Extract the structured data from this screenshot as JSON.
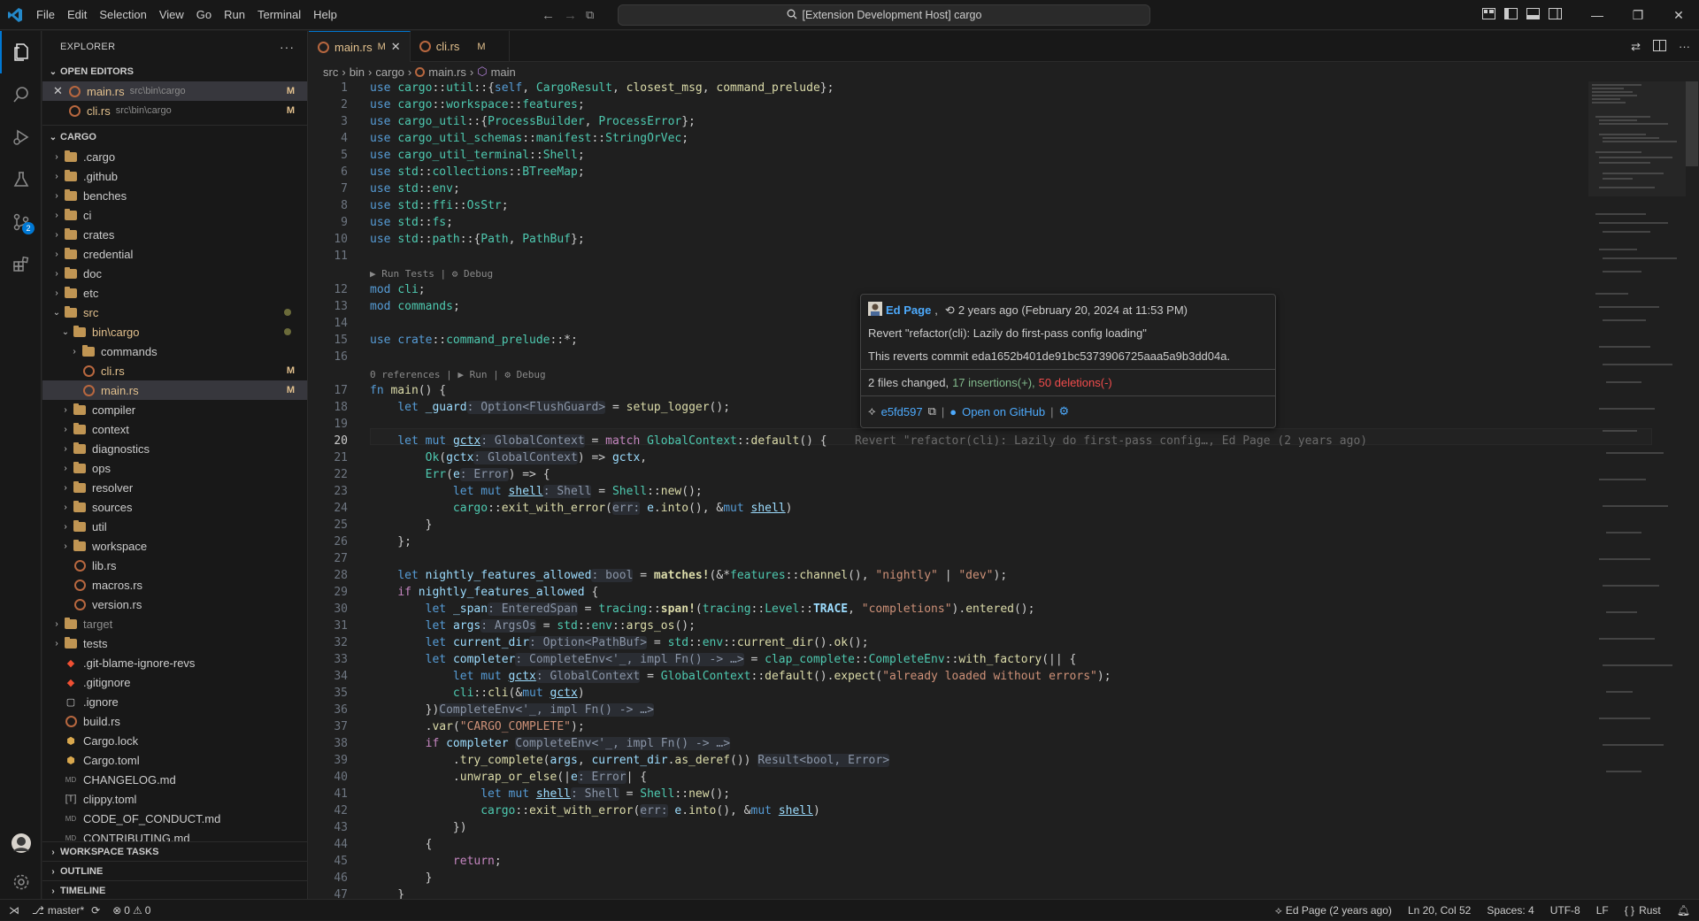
{
  "menu": [
    "File",
    "Edit",
    "Selection",
    "View",
    "Go",
    "Run",
    "Terminal",
    "Help"
  ],
  "command_center": "[Extension Development Host] cargo",
  "sidebar": {
    "title": "EXPLORER",
    "open_editors_label": "OPEN EDITORS",
    "open_editors": [
      {
        "name": "main.rs",
        "path": "src\\bin\\cargo",
        "deco": "M"
      },
      {
        "name": "cli.rs",
        "path": "src\\bin\\cargo",
        "deco": "M"
      }
    ],
    "root_label": "CARGO",
    "tree": [
      {
        "name": ".cargo"
      },
      {
        "name": ".github"
      },
      {
        "name": "benches"
      },
      {
        "name": "ci"
      },
      {
        "name": "crates"
      },
      {
        "name": "credential"
      },
      {
        "name": "doc"
      },
      {
        "name": "etc"
      },
      {
        "name": "src"
      },
      {
        "name": "bin\\cargo"
      },
      {
        "name": "commands"
      },
      {
        "name": "cli.rs",
        "deco": "M"
      },
      {
        "name": "main.rs",
        "deco": "M"
      },
      {
        "name": "compiler"
      },
      {
        "name": "context"
      },
      {
        "name": "diagnostics"
      },
      {
        "name": "ops"
      },
      {
        "name": "resolver"
      },
      {
        "name": "sources"
      },
      {
        "name": "util"
      },
      {
        "name": "workspace"
      },
      {
        "name": "lib.rs"
      },
      {
        "name": "macros.rs"
      },
      {
        "name": "version.rs"
      },
      {
        "name": "target"
      },
      {
        "name": "tests"
      },
      {
        "name": ".git-blame-ignore-revs"
      },
      {
        "name": ".gitignore"
      },
      {
        "name": ".ignore"
      },
      {
        "name": "build.rs"
      },
      {
        "name": "Cargo.lock"
      },
      {
        "name": "Cargo.toml"
      },
      {
        "name": "CHANGELOG.md"
      },
      {
        "name": "clippy.toml"
      },
      {
        "name": "CODE_OF_CONDUCT.md"
      },
      {
        "name": "CONTRIBUTING.md"
      }
    ],
    "workspace_tasks": "WORKSPACE TASKS",
    "outline": "OUTLINE",
    "timeline": "TIMELINE"
  },
  "tabs": [
    {
      "label": "main.rs",
      "deco": "M",
      "active": true
    },
    {
      "label": "cli.rs",
      "deco": "M",
      "active": false
    }
  ],
  "breadcrumb": [
    "src",
    "bin",
    "cargo",
    "main.rs",
    "main"
  ],
  "codelens": {
    "a": "▶ Run Tests | ⚙ Debug",
    "b": "0 references | ▶ Run | ⚙ Debug"
  },
  "blame_inline": "Revert \"refactor(cli): Lazily do first-pass config…, Ed Page (2 years ago)",
  "hover": {
    "author": "Ed Page",
    "when": "2 years ago (February 20, 2024 at 11:53 PM)",
    "message": "Revert \"refactor(cli): Lazily do first-pass config loading\"",
    "body": "This reverts commit eda1652b401de91bc5373906725aaa5a9b3dd04a.",
    "files_changed": "2 files changed,",
    "insertions": "17 insertions(+),",
    "deletions": "50 deletions(-)",
    "commit": "e5fd597",
    "open_github": "Open on GitHub"
  },
  "status": {
    "branch": "master*",
    "errors": "0",
    "warnings": "0",
    "blame": "Ed Page (2 years ago)",
    "position": "Ln 20, Col 52",
    "spaces": "Spaces: 4",
    "encoding": "UTF-8",
    "eol": "LF",
    "language": "Rust"
  },
  "activity_badge": "2",
  "colors": {
    "accent": "#0078d4",
    "modified": "#e2c08d",
    "deleted": "#f14c4c",
    "inserted": "#81b88b"
  }
}
